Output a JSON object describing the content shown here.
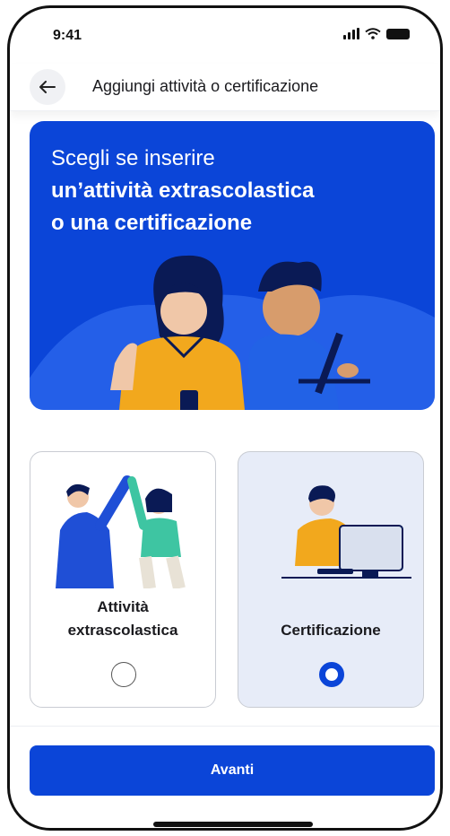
{
  "status_bar": {
    "time": "9:41"
  },
  "header": {
    "title": "Aggiungi attività o certificazione"
  },
  "hero": {
    "line1": "Scegli se inserire",
    "line2": "un’attività extrascolastica",
    "line3": "o una certificazione",
    "background_color": "#0b45d8"
  },
  "options": [
    {
      "label_line1": "Attività",
      "label_line2": "extrascolastica",
      "selected": false
    },
    {
      "label": "Certificazione",
      "selected": true
    }
  ],
  "cta": {
    "label": "Avanti"
  },
  "colors": {
    "accent": "#0b45d8",
    "selected_card_bg": "#e7ecf8"
  }
}
